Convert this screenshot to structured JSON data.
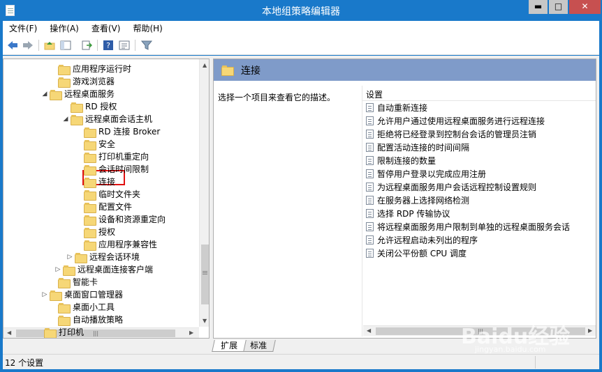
{
  "window": {
    "title": "本地组策略编辑器",
    "minimize": "▬",
    "maximize": "□",
    "close": "✕"
  },
  "menu": [
    "文件(F)",
    "操作(A)",
    "查看(V)",
    "帮助(H)"
  ],
  "toolbar": {
    "icons": [
      "back-icon",
      "forward-icon",
      "up-folder-icon",
      "show-hide-tree-icon",
      "export-list-icon",
      "help-icon",
      "properties-icon",
      "filter-icon"
    ]
  },
  "tree": {
    "nodes": [
      {
        "label": "应用程序运行时",
        "arrow": ""
      },
      {
        "label": "游戏浏览器",
        "arrow": ""
      },
      {
        "label": "远程桌面服务",
        "arrow": "◢"
      },
      {
        "label": "RD 授权",
        "arrow": ""
      },
      {
        "label": "远程桌面会话主机",
        "arrow": "◢"
      },
      {
        "label": "RD 连接 Broker",
        "arrow": ""
      },
      {
        "label": "安全",
        "arrow": ""
      },
      {
        "label": "打印机重定向",
        "arrow": ""
      },
      {
        "label": "会话时间限制",
        "arrow": ""
      },
      {
        "label": "连接",
        "arrow": ""
      },
      {
        "label": "临时文件夹",
        "arrow": ""
      },
      {
        "label": "配置文件",
        "arrow": ""
      },
      {
        "label": "设备和资源重定向",
        "arrow": ""
      },
      {
        "label": "授权",
        "arrow": ""
      },
      {
        "label": "应用程序兼容性",
        "arrow": ""
      },
      {
        "label": "远程会话环境",
        "arrow": "▷"
      },
      {
        "label": "远程桌面连接客户端",
        "arrow": "▷"
      },
      {
        "label": "智能卡",
        "arrow": ""
      },
      {
        "label": "桌面窗口管理器",
        "arrow": "▷"
      },
      {
        "label": "桌面小工具",
        "arrow": ""
      },
      {
        "label": "自动播放策略",
        "arrow": ""
      },
      {
        "label": "打印机",
        "arrow": ""
      }
    ],
    "selected": "连接"
  },
  "right": {
    "header": "连接",
    "description": "选择一个项目来查看它的描述。",
    "column": "设置",
    "settings": [
      "自动重新连接",
      "允许用户通过使用远程桌面服务进行远程连接",
      "拒绝将已经登录到控制台会话的管理员注销",
      "配置活动连接的时间间隔",
      "限制连接的数量",
      "暂停用户登录以完成应用注册",
      "为远程桌面服务用户会话远程控制设置规则",
      "在服务器上选择网络检测",
      "选择 RDP 传输协议",
      "将远程桌面服务用户限制到单独的远程桌面服务会话",
      "允许远程启动未列出的程序",
      "关闭公平份额 CPU 调度"
    ]
  },
  "tabs": [
    "扩展",
    "标准"
  ],
  "status": "12 个设置",
  "scroll_grip": "|||",
  "watermark": {
    "text": "Baidu经验",
    "sub": "jingyan.baidu.com"
  },
  "colors": {
    "title_bar": "#1979ca",
    "header": "#7f9bc9",
    "selection_box": "#e01010"
  }
}
